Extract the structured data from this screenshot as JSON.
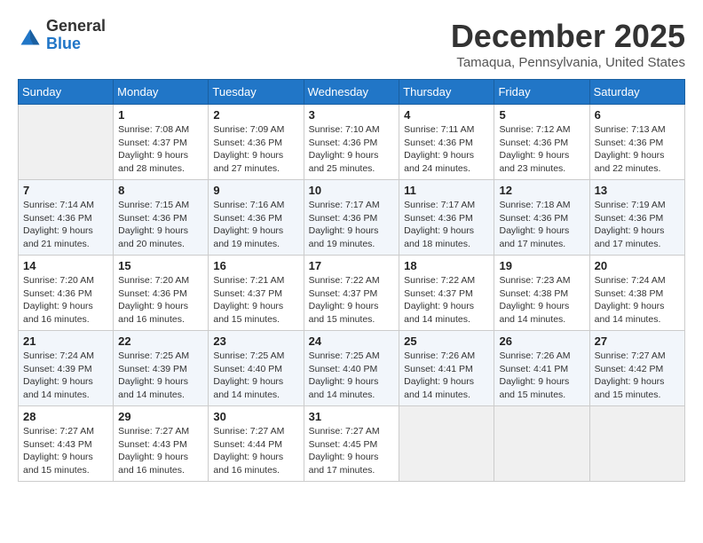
{
  "logo": {
    "general": "General",
    "blue": "Blue"
  },
  "title": "December 2025",
  "location": "Tamaqua, Pennsylvania, United States",
  "days_of_week": [
    "Sunday",
    "Monday",
    "Tuesday",
    "Wednesday",
    "Thursday",
    "Friday",
    "Saturday"
  ],
  "weeks": [
    [
      {
        "day": "",
        "sunrise": "",
        "sunset": "",
        "daylight": ""
      },
      {
        "day": "1",
        "sunrise": "Sunrise: 7:08 AM",
        "sunset": "Sunset: 4:37 PM",
        "daylight": "Daylight: 9 hours and 28 minutes."
      },
      {
        "day": "2",
        "sunrise": "Sunrise: 7:09 AM",
        "sunset": "Sunset: 4:36 PM",
        "daylight": "Daylight: 9 hours and 27 minutes."
      },
      {
        "day": "3",
        "sunrise": "Sunrise: 7:10 AM",
        "sunset": "Sunset: 4:36 PM",
        "daylight": "Daylight: 9 hours and 25 minutes."
      },
      {
        "day": "4",
        "sunrise": "Sunrise: 7:11 AM",
        "sunset": "Sunset: 4:36 PM",
        "daylight": "Daylight: 9 hours and 24 minutes."
      },
      {
        "day": "5",
        "sunrise": "Sunrise: 7:12 AM",
        "sunset": "Sunset: 4:36 PM",
        "daylight": "Daylight: 9 hours and 23 minutes."
      },
      {
        "day": "6",
        "sunrise": "Sunrise: 7:13 AM",
        "sunset": "Sunset: 4:36 PM",
        "daylight": "Daylight: 9 hours and 22 minutes."
      }
    ],
    [
      {
        "day": "7",
        "sunrise": "Sunrise: 7:14 AM",
        "sunset": "Sunset: 4:36 PM",
        "daylight": "Daylight: 9 hours and 21 minutes."
      },
      {
        "day": "8",
        "sunrise": "Sunrise: 7:15 AM",
        "sunset": "Sunset: 4:36 PM",
        "daylight": "Daylight: 9 hours and 20 minutes."
      },
      {
        "day": "9",
        "sunrise": "Sunrise: 7:16 AM",
        "sunset": "Sunset: 4:36 PM",
        "daylight": "Daylight: 9 hours and 19 minutes."
      },
      {
        "day": "10",
        "sunrise": "Sunrise: 7:17 AM",
        "sunset": "Sunset: 4:36 PM",
        "daylight": "Daylight: 9 hours and 19 minutes."
      },
      {
        "day": "11",
        "sunrise": "Sunrise: 7:17 AM",
        "sunset": "Sunset: 4:36 PM",
        "daylight": "Daylight: 9 hours and 18 minutes."
      },
      {
        "day": "12",
        "sunrise": "Sunrise: 7:18 AM",
        "sunset": "Sunset: 4:36 PM",
        "daylight": "Daylight: 9 hours and 17 minutes."
      },
      {
        "day": "13",
        "sunrise": "Sunrise: 7:19 AM",
        "sunset": "Sunset: 4:36 PM",
        "daylight": "Daylight: 9 hours and 17 minutes."
      }
    ],
    [
      {
        "day": "14",
        "sunrise": "Sunrise: 7:20 AM",
        "sunset": "Sunset: 4:36 PM",
        "daylight": "Daylight: 9 hours and 16 minutes."
      },
      {
        "day": "15",
        "sunrise": "Sunrise: 7:20 AM",
        "sunset": "Sunset: 4:36 PM",
        "daylight": "Daylight: 9 hours and 16 minutes."
      },
      {
        "day": "16",
        "sunrise": "Sunrise: 7:21 AM",
        "sunset": "Sunset: 4:37 PM",
        "daylight": "Daylight: 9 hours and 15 minutes."
      },
      {
        "day": "17",
        "sunrise": "Sunrise: 7:22 AM",
        "sunset": "Sunset: 4:37 PM",
        "daylight": "Daylight: 9 hours and 15 minutes."
      },
      {
        "day": "18",
        "sunrise": "Sunrise: 7:22 AM",
        "sunset": "Sunset: 4:37 PM",
        "daylight": "Daylight: 9 hours and 14 minutes."
      },
      {
        "day": "19",
        "sunrise": "Sunrise: 7:23 AM",
        "sunset": "Sunset: 4:38 PM",
        "daylight": "Daylight: 9 hours and 14 minutes."
      },
      {
        "day": "20",
        "sunrise": "Sunrise: 7:24 AM",
        "sunset": "Sunset: 4:38 PM",
        "daylight": "Daylight: 9 hours and 14 minutes."
      }
    ],
    [
      {
        "day": "21",
        "sunrise": "Sunrise: 7:24 AM",
        "sunset": "Sunset: 4:39 PM",
        "daylight": "Daylight: 9 hours and 14 minutes."
      },
      {
        "day": "22",
        "sunrise": "Sunrise: 7:25 AM",
        "sunset": "Sunset: 4:39 PM",
        "daylight": "Daylight: 9 hours and 14 minutes."
      },
      {
        "day": "23",
        "sunrise": "Sunrise: 7:25 AM",
        "sunset": "Sunset: 4:40 PM",
        "daylight": "Daylight: 9 hours and 14 minutes."
      },
      {
        "day": "24",
        "sunrise": "Sunrise: 7:25 AM",
        "sunset": "Sunset: 4:40 PM",
        "daylight": "Daylight: 9 hours and 14 minutes."
      },
      {
        "day": "25",
        "sunrise": "Sunrise: 7:26 AM",
        "sunset": "Sunset: 4:41 PM",
        "daylight": "Daylight: 9 hours and 14 minutes."
      },
      {
        "day": "26",
        "sunrise": "Sunrise: 7:26 AM",
        "sunset": "Sunset: 4:41 PM",
        "daylight": "Daylight: 9 hours and 15 minutes."
      },
      {
        "day": "27",
        "sunrise": "Sunrise: 7:27 AM",
        "sunset": "Sunset: 4:42 PM",
        "daylight": "Daylight: 9 hours and 15 minutes."
      }
    ],
    [
      {
        "day": "28",
        "sunrise": "Sunrise: 7:27 AM",
        "sunset": "Sunset: 4:43 PM",
        "daylight": "Daylight: 9 hours and 15 minutes."
      },
      {
        "day": "29",
        "sunrise": "Sunrise: 7:27 AM",
        "sunset": "Sunset: 4:43 PM",
        "daylight": "Daylight: 9 hours and 16 minutes."
      },
      {
        "day": "30",
        "sunrise": "Sunrise: 7:27 AM",
        "sunset": "Sunset: 4:44 PM",
        "daylight": "Daylight: 9 hours and 16 minutes."
      },
      {
        "day": "31",
        "sunrise": "Sunrise: 7:27 AM",
        "sunset": "Sunset: 4:45 PM",
        "daylight": "Daylight: 9 hours and 17 minutes."
      },
      {
        "day": "",
        "sunrise": "",
        "sunset": "",
        "daylight": ""
      },
      {
        "day": "",
        "sunrise": "",
        "sunset": "",
        "daylight": ""
      },
      {
        "day": "",
        "sunrise": "",
        "sunset": "",
        "daylight": ""
      }
    ]
  ]
}
